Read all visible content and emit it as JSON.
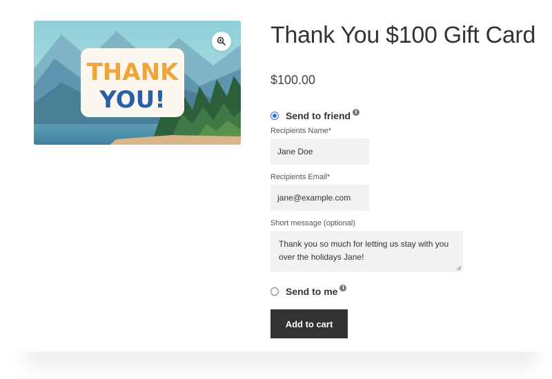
{
  "product": {
    "title": "Thank You $100 Gift Card",
    "price": "$100.00",
    "image": {
      "line1": "THANK",
      "line2": "YOU!",
      "zoom_icon": "zoom-in-icon"
    }
  },
  "options": {
    "send_to_friend": {
      "label": "Send to friend",
      "checked": true,
      "info_icon": "info-icon"
    },
    "send_to_me": {
      "label": "Send to me",
      "checked": false,
      "info_icon": "info-icon"
    }
  },
  "form": {
    "recipient_name": {
      "label": "Recipients Name*",
      "value": "Jane Doe"
    },
    "recipient_email": {
      "label": "Recipients Email*",
      "value": "jane@example.com"
    },
    "message": {
      "label": "Short message (optional)",
      "value": "Thank you so much for letting us stay with you over the holidays Jane!"
    }
  },
  "actions": {
    "add_to_cart_label": "Add to cart"
  },
  "colors": {
    "accent": "#2f6fde",
    "button_bg": "#333333",
    "input_bg": "#f2f2f2"
  }
}
